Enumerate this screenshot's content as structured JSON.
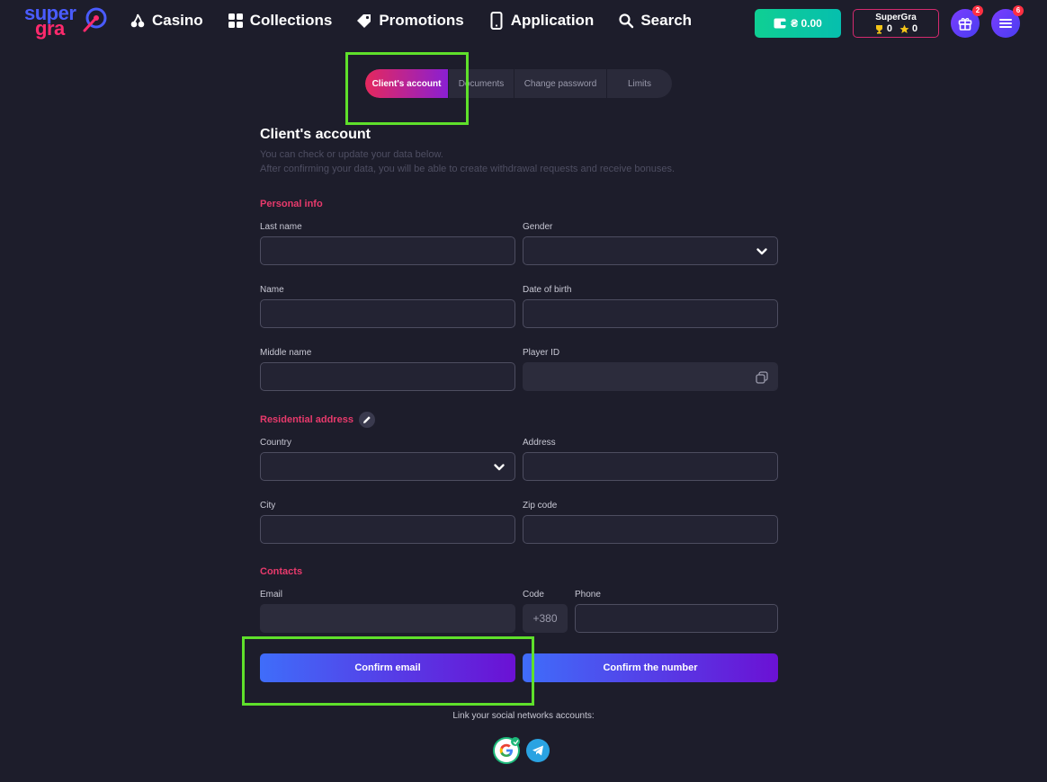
{
  "header": {
    "logo_top": "super",
    "logo_bottom": "gra",
    "nav": [
      {
        "label": "Casino",
        "icon": "cherries-icon"
      },
      {
        "label": "Collections",
        "icon": "grid-icon"
      },
      {
        "label": "Promotions",
        "icon": "tag-icon"
      },
      {
        "label": "Application",
        "icon": "phone-icon"
      },
      {
        "label": "Search",
        "icon": "search-icon"
      }
    ],
    "balance": "₴ 0.00",
    "user_name": "SuperGra",
    "trophies": "0",
    "stars": "0",
    "gift_badge": "2",
    "menu_badge": "6"
  },
  "tabs": [
    {
      "label": "Client's account",
      "active": true
    },
    {
      "label": "Documents",
      "active": false
    },
    {
      "label": "Change password",
      "active": false
    },
    {
      "label": "Limits",
      "active": false
    }
  ],
  "page": {
    "title": "Client's account",
    "subtitle_1": "You can check or update your data below.",
    "subtitle_2": "After confirming your data, you will be able to create withdrawal requests and receive bonuses."
  },
  "personal": {
    "heading": "Personal info",
    "last_name_label": "Last name",
    "last_name_value": "",
    "gender_label": "Gender",
    "gender_value": "",
    "name_label": "Name",
    "name_value": "",
    "dob_label": "Date of birth",
    "dob_value": "",
    "middle_label": "Middle name",
    "middle_value": "",
    "player_id_label": "Player ID",
    "player_id_value": ""
  },
  "address": {
    "heading": "Residential address",
    "country_label": "Country",
    "country_value": "",
    "address_label": "Address",
    "address_value": "",
    "city_label": "City",
    "city_value": "",
    "zip_label": "Zip code",
    "zip_value": ""
  },
  "contacts": {
    "heading": "Contacts",
    "email_label": "Email",
    "email_value": "",
    "code_label": "Code",
    "code_value": "+380",
    "phone_label": "Phone",
    "phone_value": "",
    "confirm_email": "Confirm email",
    "confirm_number": "Confirm the number"
  },
  "social": {
    "label": "Link your social networks accounts:",
    "google_linked": true
  },
  "colors": {
    "background": "#1d1d2b",
    "accent_pink": "#e83a6c",
    "highlight_green": "#5fe02b",
    "balance_green": "#0fcf93"
  }
}
